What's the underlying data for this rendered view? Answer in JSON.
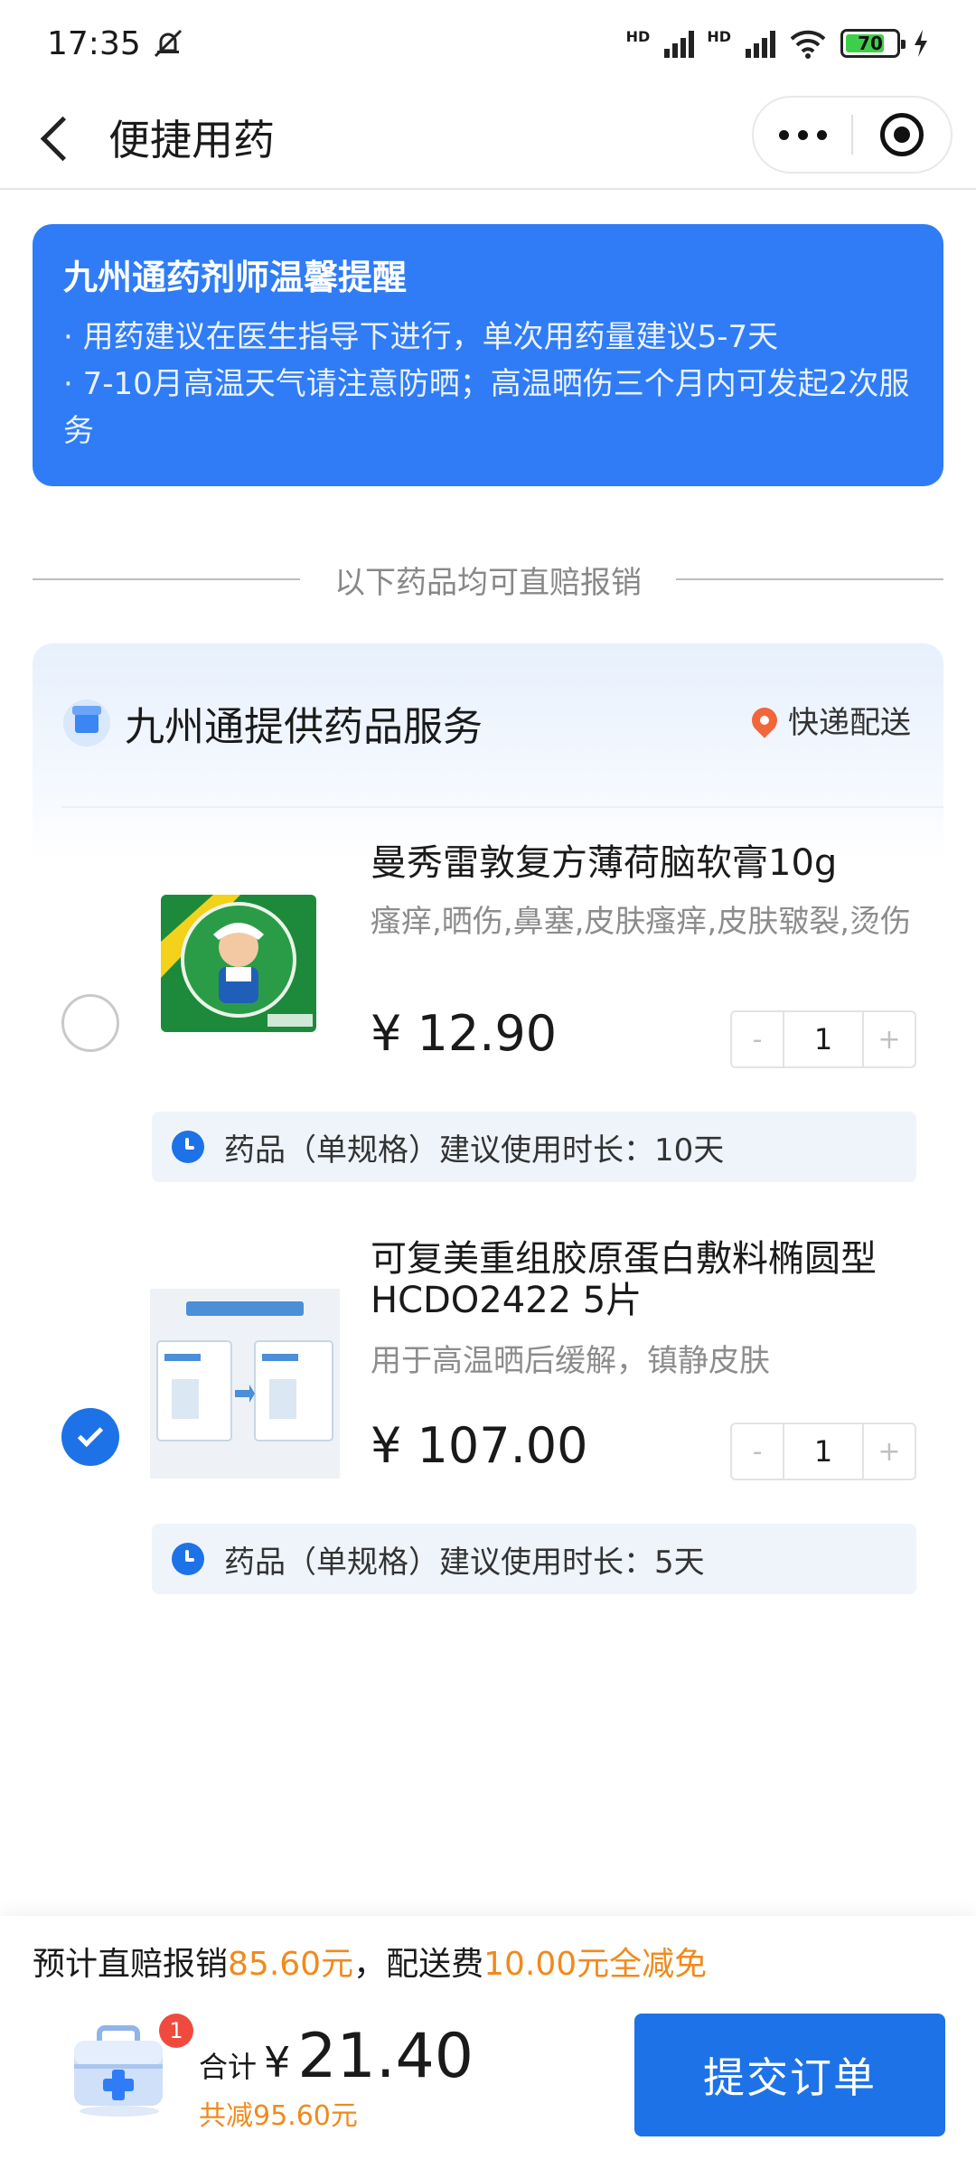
{
  "status_bar": {
    "time": "17:35",
    "network_label_1": "HD",
    "network_label_2": "HD",
    "battery": "70"
  },
  "nav": {
    "title": "便捷用药"
  },
  "notice": {
    "title": "九州通药剂师温馨提醒",
    "line1": "· 用药建议在医生指导下进行，单次用药量建议5-7天",
    "line2": "· 7-10月高温天气请注意防晒；高温晒伤三个月内可发起2次服务"
  },
  "divider_text": "以下药品均可直赔报销",
  "service": {
    "title": "九州通提供药品服务",
    "delivery": "快递配送",
    "items": [
      {
        "name": "曼秀雷敦复方薄荷脑软膏10g",
        "desc": "瘙痒,晒伤,鼻塞,皮肤瘙痒,皮肤皲裂,烫伤",
        "price": "¥ 12.90",
        "qty": "1",
        "minus": "-",
        "plus": "+",
        "selected": false,
        "tip": "药品（单规格）建议使用时长：10天"
      },
      {
        "name": "可复美重组胶原蛋白敷料椭圆型 HCDO2422 5片",
        "desc": "用于高温晒后缓解，镇静皮肤",
        "price": "¥ 107.00",
        "qty": "1",
        "minus": "-",
        "plus": "+",
        "selected": true,
        "tip": "药品（单规格）建议使用时长：5天"
      }
    ]
  },
  "bottom": {
    "reimb_prefix": "预计直赔报销",
    "reimb_amount": "85.60元",
    "reimb_mid": "，配送费",
    "delivery_fee": "10.00元全减免",
    "cart_count": "1",
    "total_label": "合计",
    "currency": "¥",
    "total_amount": "21.40",
    "saved": "共减95.60元",
    "submit": "提交订单"
  },
  "colors": {
    "primary": "#1e72e8",
    "notice_bg": "#2f7cf6",
    "accent_orange": "#f08a1d",
    "badge_red": "#f04a3f"
  }
}
